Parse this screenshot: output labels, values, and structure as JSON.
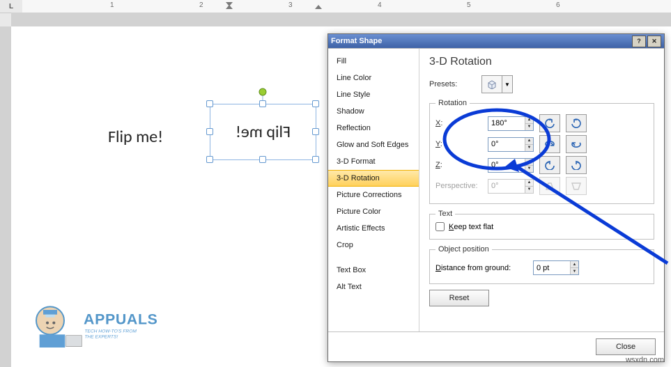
{
  "ruler": {
    "labels": [
      "1",
      "2",
      "3",
      "4",
      "5",
      "6"
    ]
  },
  "doc": {
    "static_text": "Flip me!",
    "textbox_text": "Flip me!"
  },
  "dialog": {
    "title": "Format Shape",
    "nav": {
      "items": [
        "Fill",
        "Line Color",
        "Line Style",
        "Shadow",
        "Reflection",
        "Glow and Soft Edges",
        "3-D Format",
        "3-D Rotation",
        "Picture Corrections",
        "Picture Color",
        "Artistic Effects",
        "Crop",
        "Text Box",
        "Alt Text"
      ],
      "selected_index": 7
    },
    "panel": {
      "title": "3-D Rotation",
      "presets_label": "Presets:",
      "rotation": {
        "legend": "Rotation",
        "x_label": "X:",
        "x_value": "180°",
        "y_label": "Y:",
        "y_value": "0°",
        "z_label": "Z:",
        "z_value": "0°",
        "perspective_label": "Perspective:",
        "perspective_value": "0°"
      },
      "text": {
        "legend": "Text",
        "keep_flat_label": "Keep text flat",
        "keep_flat_checked": false
      },
      "objpos": {
        "legend": "Object position",
        "distance_label": "Distance from ground:",
        "distance_value": "0 pt"
      },
      "reset_label": "Reset",
      "close_label": "Close"
    }
  },
  "watermark": {
    "brand": "APPUALS",
    "tagline": "TECH HOW-TO'S FROM THE EXPERTS!"
  },
  "note": "wsxdn.com"
}
